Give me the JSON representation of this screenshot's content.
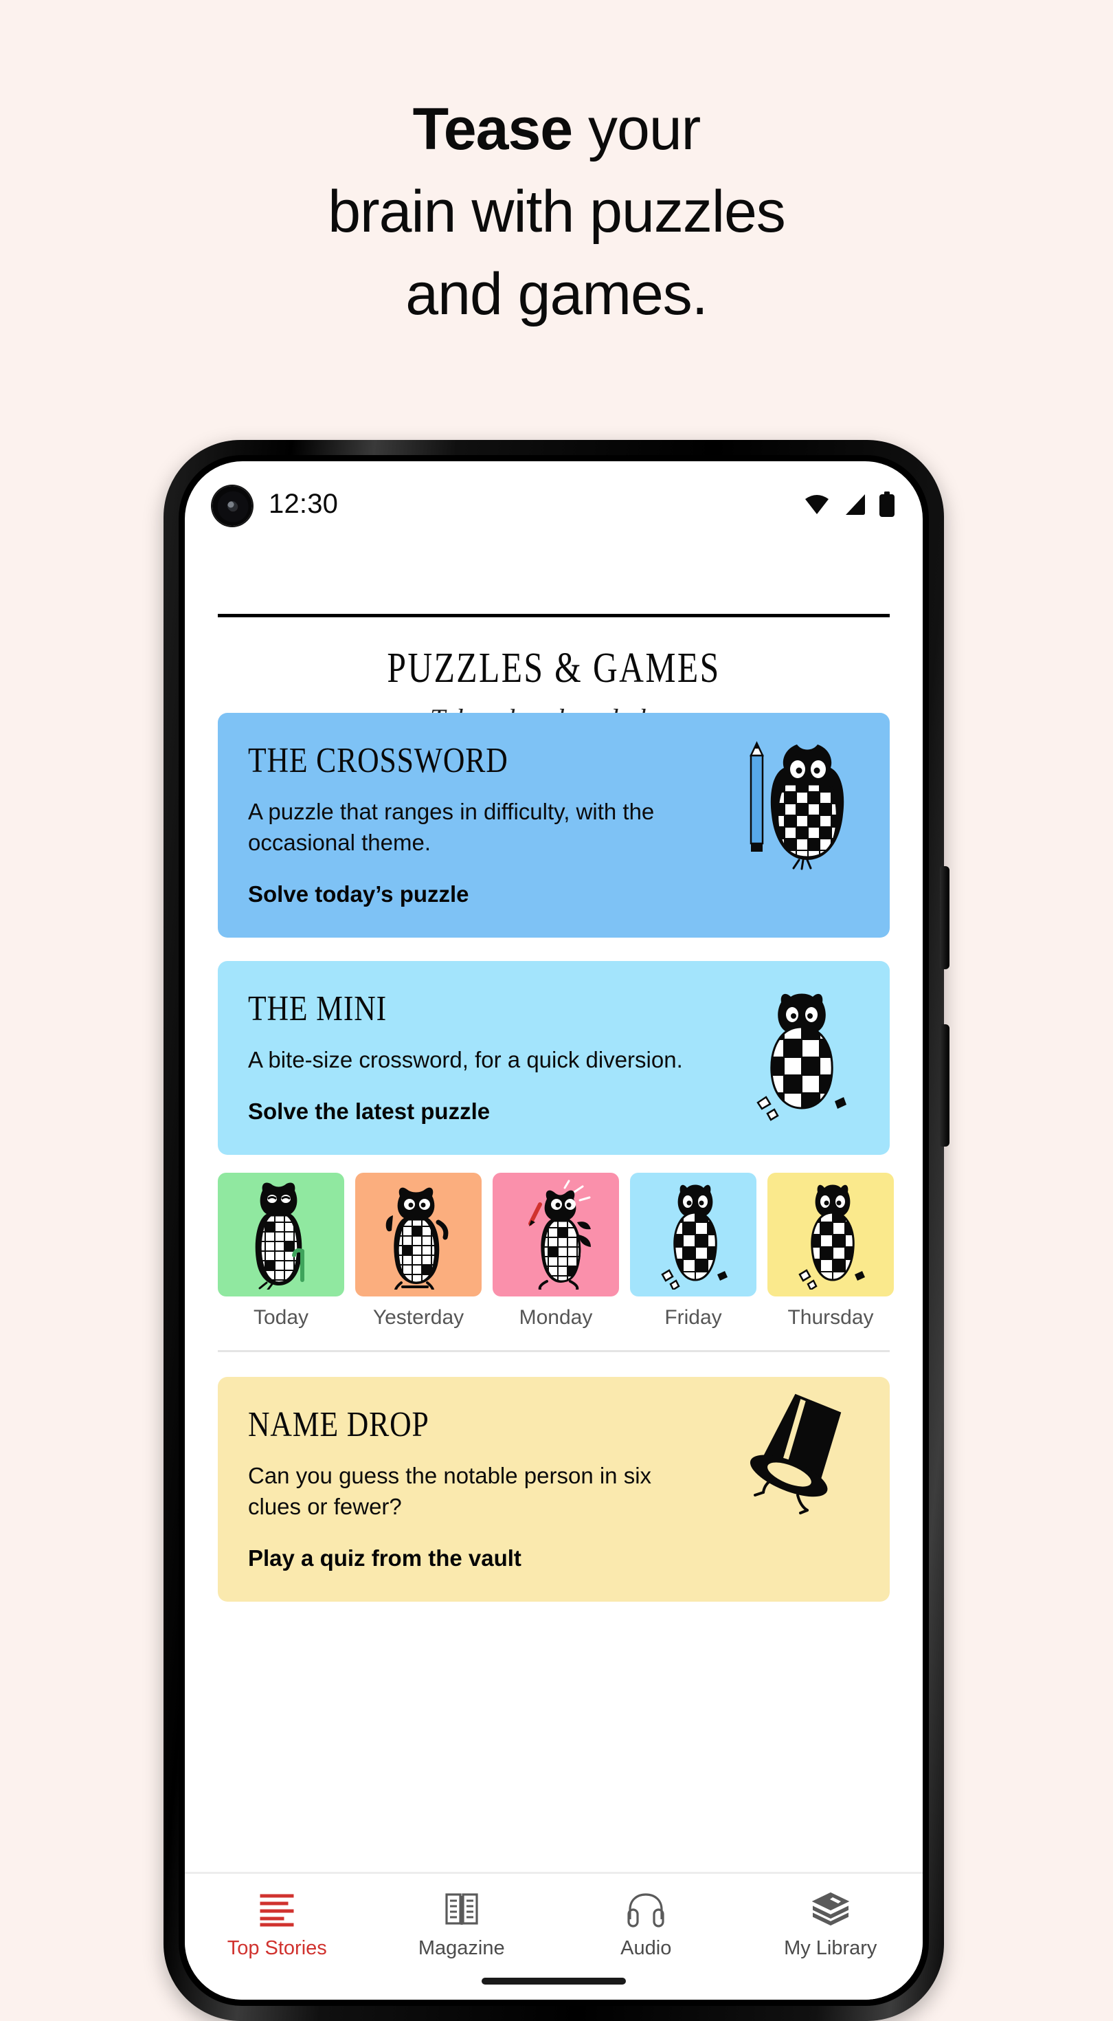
{
  "hero": {
    "line1_bold": "Tease",
    "line1_rest": " your",
    "line2": "brain with puzzles",
    "line3": "and games."
  },
  "colors": {
    "page_background": "#FCF2EE",
    "crossword_card": "#7EC2F5",
    "mini_card": "#A3E4FC",
    "namedrop_card": "#FAE9AE",
    "accent_red": "#D0322E",
    "archive_today": "#90E8A0",
    "archive_yesterday": "#FBAE7E",
    "archive_monday": "#FA90AB",
    "archive_friday": "#A3E4FC",
    "archive_thursday": "#FAE98C"
  },
  "status_bar": {
    "time": "12:30",
    "icons": [
      "wifi-icon",
      "cell-signal-icon",
      "battery-icon"
    ]
  },
  "masthead": {
    "title": "PUZZLES & GAMES",
    "subtitle": "Take a break and play."
  },
  "cards": [
    {
      "id": "crossword",
      "title": "THE CROSSWORD",
      "description": "A puzzle that ranges in difficulty, with the occasional theme.",
      "cta": "Solve today’s puzzle",
      "art": "owl-with-pencil-icon"
    },
    {
      "id": "mini",
      "title": "THE MINI",
      "description": "A bite-size crossword, for a quick diversion.",
      "cta": "Solve the latest puzzle",
      "art": "owl-egg-icon"
    },
    {
      "id": "namedrop",
      "title": "NAME DROP",
      "description": "Can you guess the notable person in six clues or fewer?",
      "cta": "Play a quiz from the vault",
      "art": "top-hat-icon"
    }
  ],
  "archive": [
    {
      "label": "Today",
      "art": "owl-cane-icon"
    },
    {
      "label": "Yesterday",
      "art": "owl-running-icon"
    },
    {
      "label": "Monday",
      "art": "owl-pencil-icon"
    },
    {
      "label": "Friday",
      "art": "owl-egg-icon"
    },
    {
      "label": "Thursday",
      "art": "owl-egg-icon"
    }
  ],
  "navbar": {
    "items": [
      {
        "label": "Top Stories",
        "icon": "lines-icon",
        "active": true
      },
      {
        "label": "Magazine",
        "icon": "book-icon",
        "active": false
      },
      {
        "label": "Audio",
        "icon": "headphones-icon",
        "active": false
      },
      {
        "label": "My Library",
        "icon": "books-stack-icon",
        "active": false
      }
    ]
  }
}
